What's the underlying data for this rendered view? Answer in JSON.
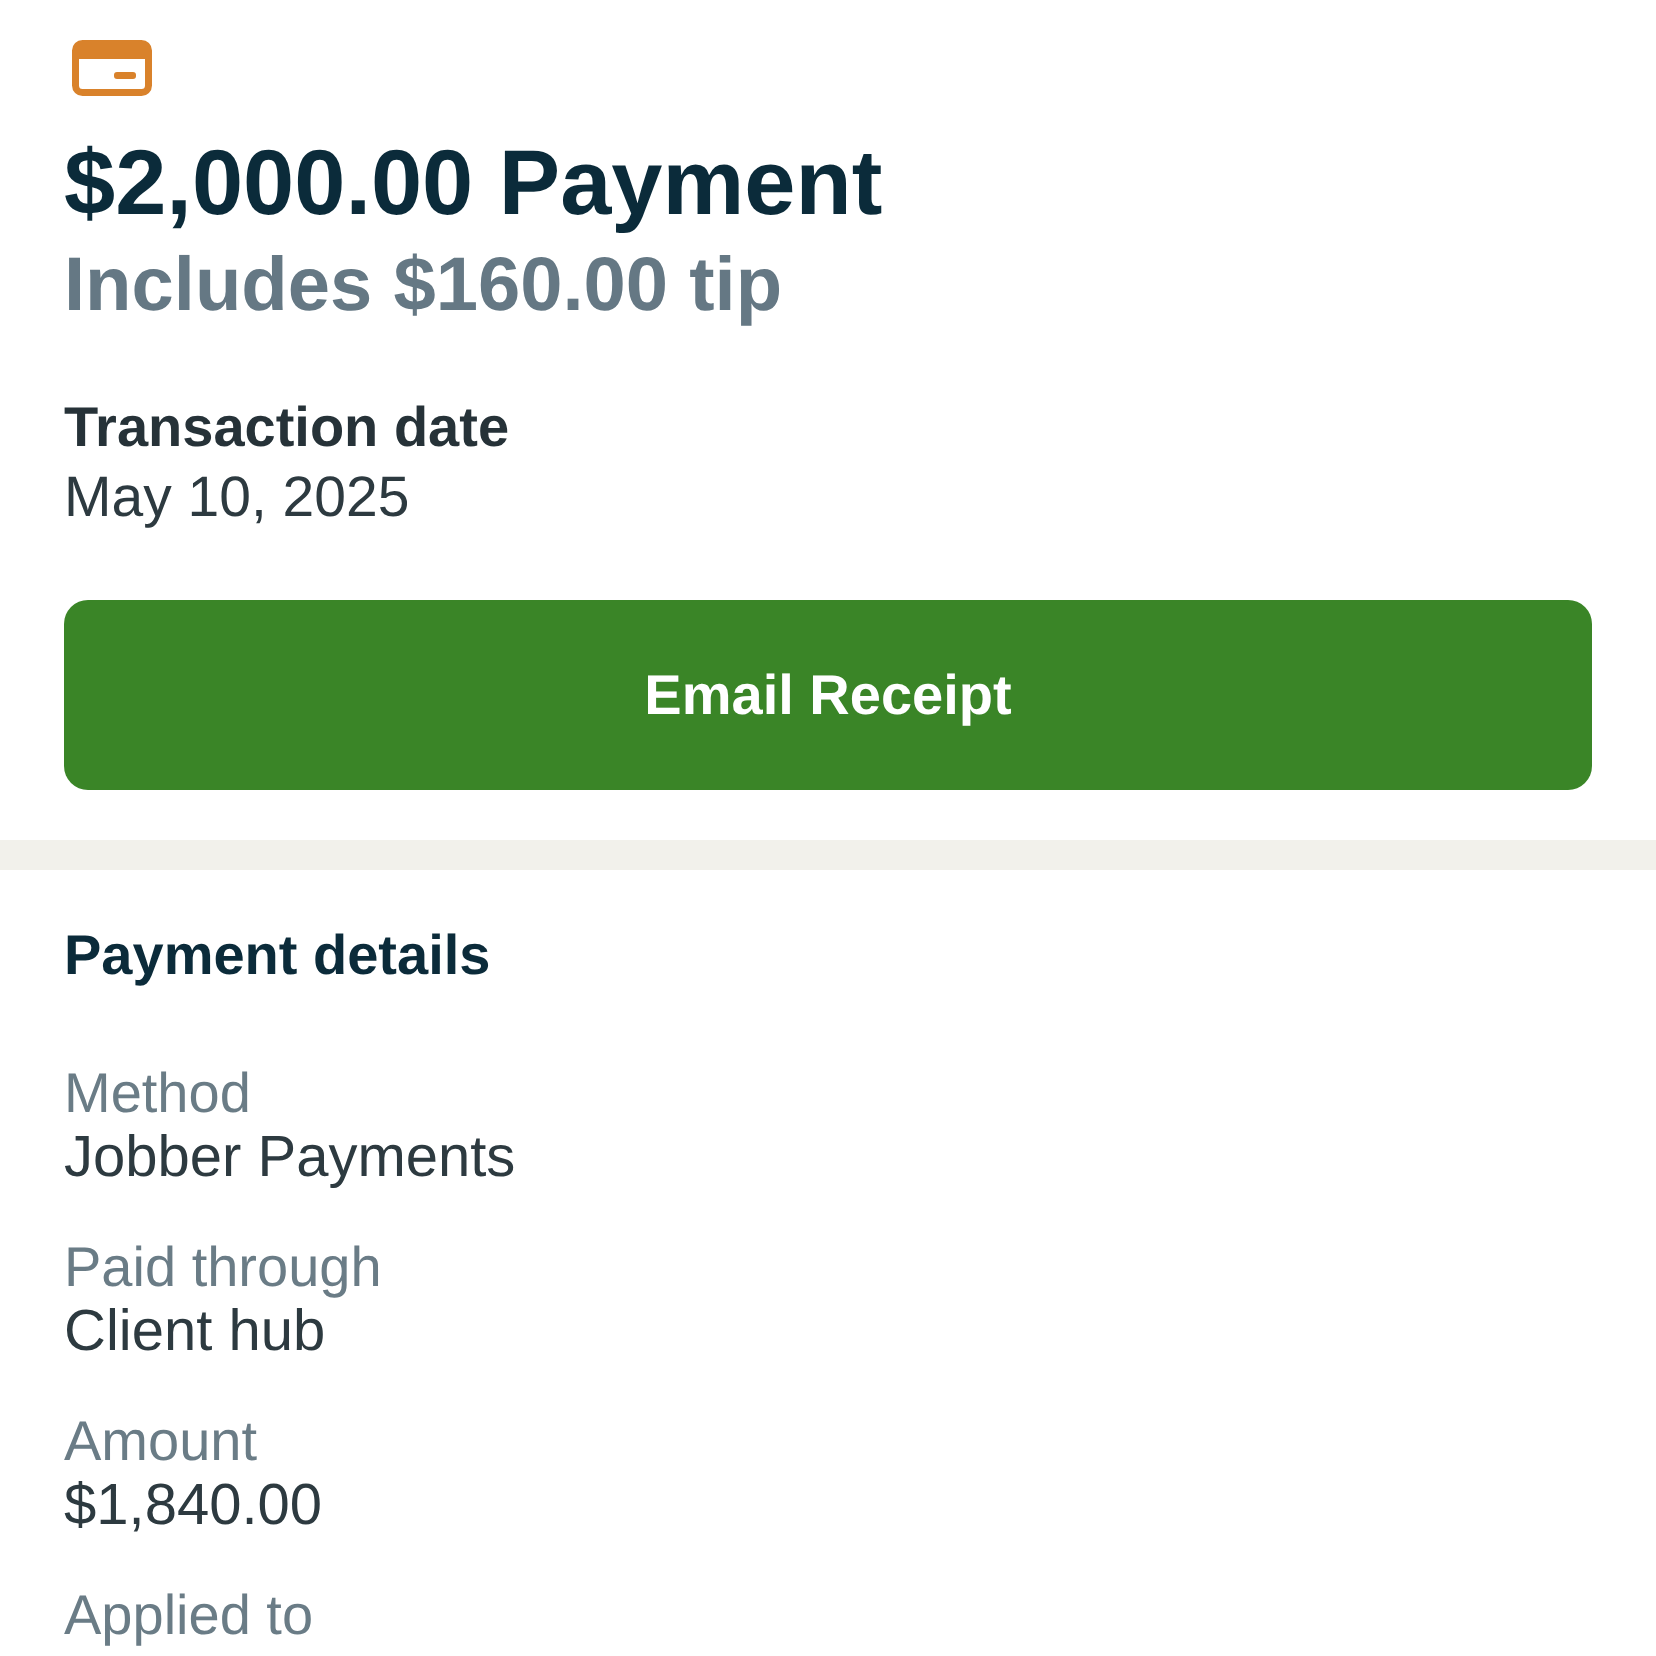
{
  "header": {
    "title": "$2,000.00 Payment",
    "subtitle": "Includes $160.00 tip"
  },
  "transaction": {
    "label": "Transaction date",
    "value": "May 10, 2025"
  },
  "email_button": {
    "label": "Email Receipt"
  },
  "payment_details": {
    "heading": "Payment details",
    "fields": [
      {
        "label": "Method",
        "value": "Jobber Payments"
      },
      {
        "label": "Paid through",
        "value": "Client hub"
      },
      {
        "label": "Amount",
        "value": "$1,840.00"
      },
      {
        "label": "Applied to"
      }
    ]
  }
}
